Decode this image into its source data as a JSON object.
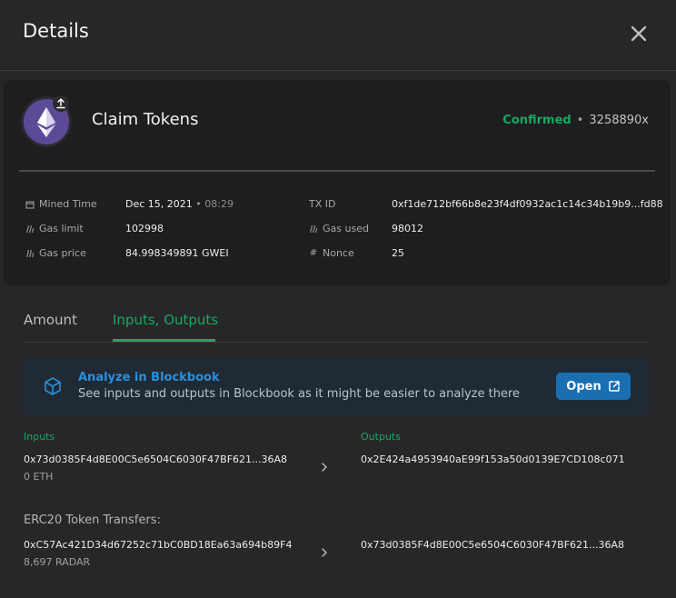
{
  "header": {
    "title": "Details"
  },
  "tx": {
    "name": "Claim Tokens",
    "status": "Confirmed",
    "separator": "•",
    "confirmations": "3258890x"
  },
  "details": {
    "mined_time": {
      "label": "Mined Time",
      "date": "Dec 15, 2021",
      "sep": "•",
      "time": "08:29"
    },
    "gas_limit": {
      "label": "Gas limit",
      "value": "102998"
    },
    "gas_price": {
      "label": "Gas price",
      "value": "84.998349891 GWEI"
    },
    "tx_id": {
      "label": "TX ID",
      "value": "0xf1de712bf66b8e23f4df0932ac1c14c34b19b9...fd88"
    },
    "gas_used": {
      "label": "Gas used",
      "value": "98012"
    },
    "nonce": {
      "label": "Nonce",
      "value": "25"
    }
  },
  "tabs": [
    {
      "label": "Amount",
      "active": false
    },
    {
      "label": "Inputs, Outputs",
      "active": true
    }
  ],
  "banner": {
    "title": "Analyze in Blockbook",
    "text": "See inputs and outputs in Blockbook as it might be easier to analyze there",
    "button": "Open"
  },
  "io": {
    "inputs_label": "Inputs",
    "outputs_label": "Outputs",
    "input_address": "0x73d0385F4d8E00C5e6504C6030F47BF621...36A8",
    "input_amount": "0 ETH",
    "output_address": "0x2E424a4953940aE99f153a50d0139E7CD108c071"
  },
  "erc20": {
    "label": "ERC20 Token Transfers:",
    "from_address": "0xC57Ac421D34d67252c71bC0BD18Ea63a694b89F4",
    "amount": "8,697 RADAR",
    "to_address": "0x73d0385F4d8E00C5e6504C6030F47BF621...36A8"
  },
  "colors": {
    "background": "#27272a",
    "card": "#1e1e20",
    "accent_green": "#1aa760",
    "link_blue": "#2b8fd9",
    "button_blue": "#1a6fb0",
    "eth_purple": "#5d4a97"
  },
  "icons": {
    "close": "close-icon",
    "token": "ethereum-icon",
    "badge": "upload-arrow-icon",
    "mined": "calendar-icon",
    "gas": "gas-icon",
    "nonce": "hash-icon",
    "blockbook": "cube-icon",
    "open": "external-link-icon",
    "chevron": "chevron-right-icon"
  }
}
